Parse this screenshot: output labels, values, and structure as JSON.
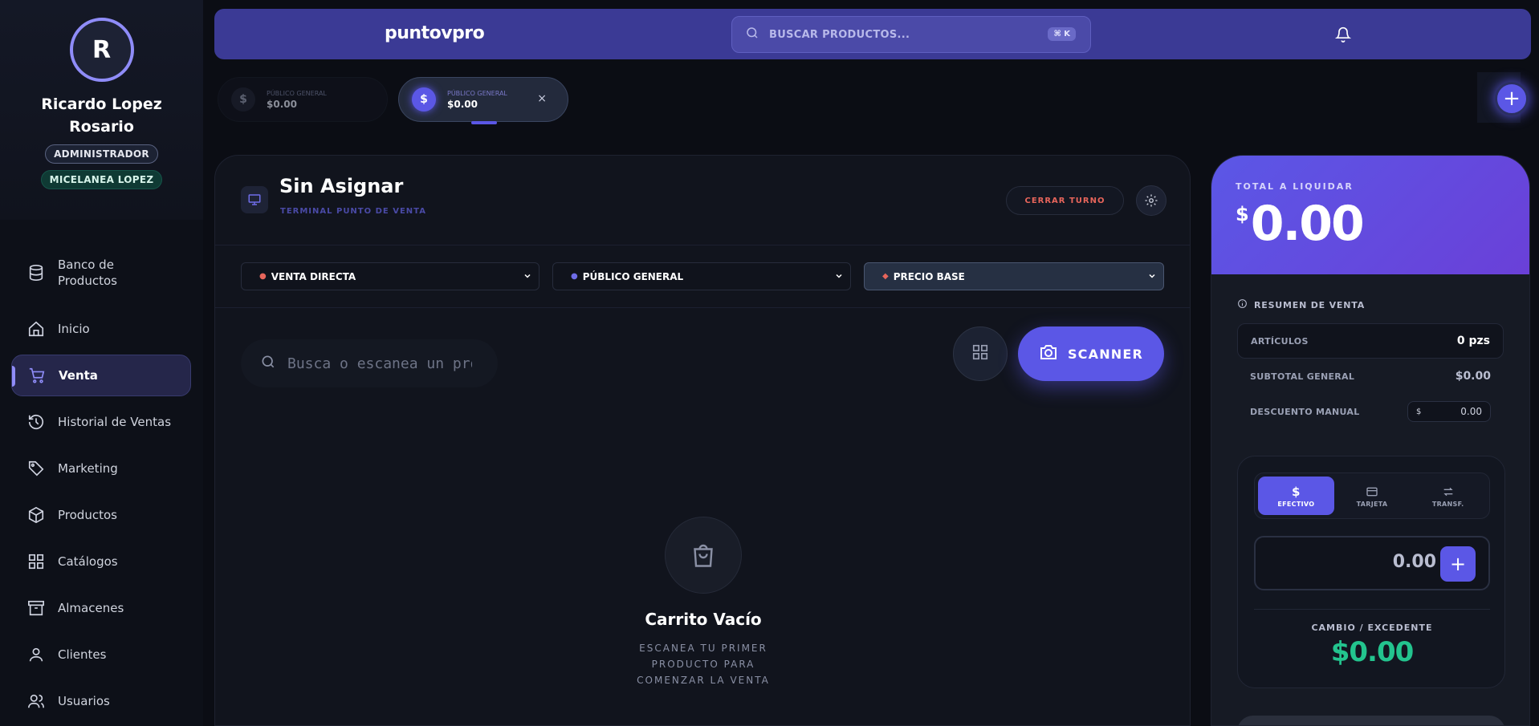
{
  "user": {
    "initial": "R",
    "name": "Ricardo Lopez Rosario",
    "role": "ADMINISTRADOR",
    "store": "MICELANEA LOPEZ"
  },
  "nav": {
    "items": [
      {
        "label": "Banco de Productos",
        "icon": "database-icon"
      },
      {
        "label": "Inicio",
        "icon": "home-icon"
      },
      {
        "label": "Venta",
        "icon": "cart-icon",
        "active": true
      },
      {
        "label": "Historial de Ventas",
        "icon": "history-icon"
      },
      {
        "label": "Marketing",
        "icon": "tag-icon"
      },
      {
        "label": "Productos",
        "icon": "box-icon"
      },
      {
        "label": "Catálogos",
        "icon": "grid-icon"
      },
      {
        "label": "Almacenes",
        "icon": "archive-icon"
      },
      {
        "label": "Clientes",
        "icon": "user-icon"
      },
      {
        "label": "Usuarios",
        "icon": "users-icon"
      }
    ]
  },
  "topbar": {
    "brand": "puntovpro",
    "search_placeholder": "BUSCAR PRODUCTOS...",
    "shortcut": "⌘ K",
    "bell_icon": "bell-icon"
  },
  "sale_tabs": [
    {
      "currency": "$",
      "label": "PÚBLICO GENERAL",
      "amount": "$0.00"
    },
    {
      "currency": "$",
      "label": "PÚBLICO GENERAL",
      "amount": "$0.00",
      "active": true,
      "close": "×"
    }
  ],
  "add_tab_label": "+",
  "terminal": {
    "title": "Sin Asignar",
    "subtitle": "TERMINAL PUNTO DE VENTA",
    "close_shift": "CERRAR TURNO"
  },
  "filters": {
    "sale_type": "VENTA DIRECTA",
    "customer": "PÚBLICO GENERAL",
    "price_list": "PRECIO BASE"
  },
  "product_search": {
    "placeholder": "Busca o escanea un producto...",
    "scanner_label": "SCANNER"
  },
  "cart": {
    "empty_title": "Carrito Vacío",
    "empty_subtitle": "ESCANEA TU PRIMER PRODUCTO PARA COMENZAR LA VENTA"
  },
  "summary": {
    "total_label": "TOTAL A LIQUIDAR",
    "currency": "$",
    "total": "0.00",
    "header": "RESUMEN DE VENTA",
    "articles_label": "ARTÍCULOS",
    "articles_value": "0 pzs",
    "subtotal_label": "SUBTOTAL GENERAL",
    "subtotal_value": "$0.00",
    "discount_label": "DESCUENTO MANUAL",
    "discount_currency": "$",
    "discount_value": "0.00"
  },
  "payment": {
    "methods": [
      {
        "label": "EFECTIVO",
        "icon": "dollar-icon",
        "active": true
      },
      {
        "label": "TARJETA",
        "icon": "card-icon"
      },
      {
        "label": "TRANSF.",
        "icon": "transfer-icon"
      }
    ],
    "amount": "0.00",
    "add_label": "+",
    "change_label": "CAMBIO / EXCEDENTE",
    "change_value": "$0.00"
  },
  "colors": {
    "accent": "#5b57e6",
    "topbar": "#3b3a95",
    "success": "#23c48e",
    "danger": "#e7655b",
    "background": "#0b0d14"
  }
}
